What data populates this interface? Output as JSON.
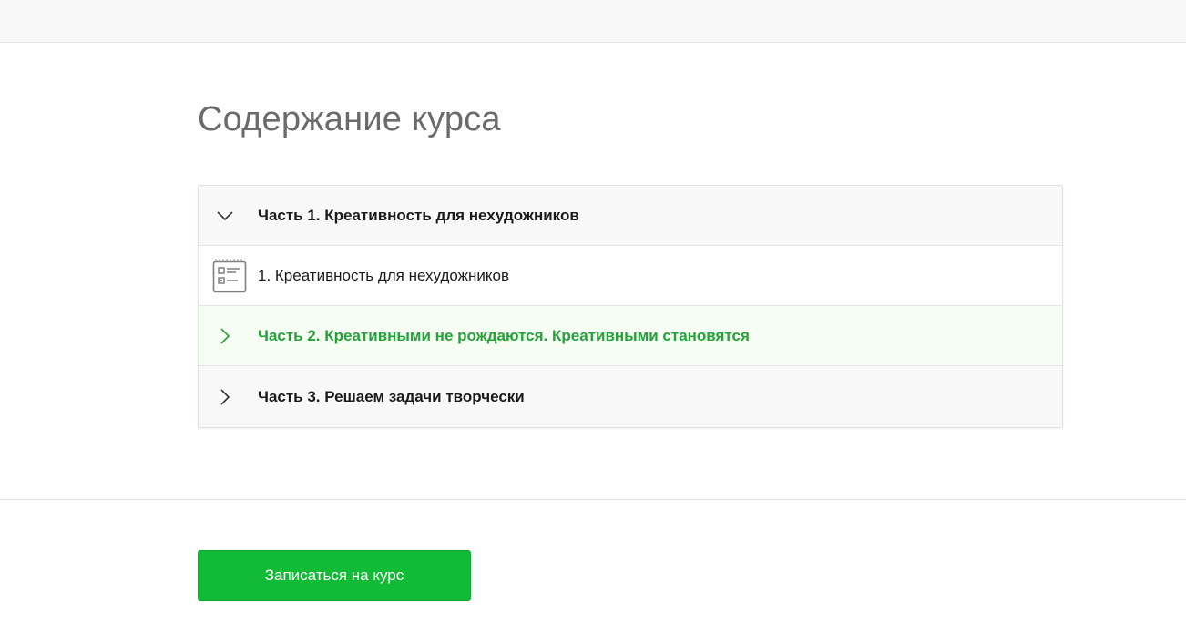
{
  "page": {
    "title": "Содержание курса"
  },
  "syllabus": {
    "sections": [
      {
        "label": "Часть 1. Креативность для нехудожников",
        "expanded": true,
        "lessons": [
          {
            "label": "1. Креативность для нехудожников",
            "icon": "lesson-list-icon"
          }
        ]
      },
      {
        "label": "Часть 2. Креативными не рождаются. Креативными становятся",
        "expanded": false,
        "highlighted": true
      },
      {
        "label": "Часть 3. Решаем задачи творчески",
        "expanded": false
      }
    ]
  },
  "actions": {
    "enroll_label": "Записаться на курс"
  },
  "colors": {
    "accent_green": "#12bb36",
    "active_section_text": "#23a23a",
    "title_gray": "#6b6b6b"
  }
}
